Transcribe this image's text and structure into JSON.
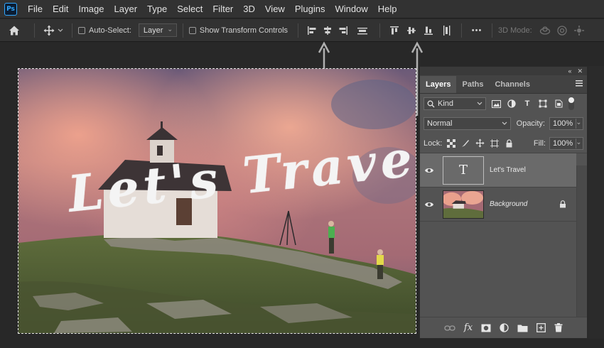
{
  "menu": [
    "File",
    "Edit",
    "Image",
    "Layer",
    "Type",
    "Select",
    "Filter",
    "3D",
    "View",
    "Plugins",
    "Window",
    "Help"
  ],
  "app_logo": "Ps",
  "options": {
    "auto_select_label": "Auto-Select:",
    "auto_select_value": "Layer",
    "show_transform_label": "Show Transform Controls",
    "more_label": "•••",
    "mode_3d_label": "3D Mode:"
  },
  "canvas": {
    "headline": "Let's Travel"
  },
  "layers_panel": {
    "tabs": [
      "Layers",
      "Paths",
      "Channels"
    ],
    "filter_kind": "Kind",
    "blend_mode": "Normal",
    "opacity_label": "Opacity:",
    "opacity_value": "100%",
    "lock_label": "Lock:",
    "fill_label": "Fill:",
    "fill_value": "100%",
    "layers": [
      {
        "name": "Let's Travel",
        "thumb_glyph": "T"
      },
      {
        "name": "Background"
      }
    ]
  },
  "icons": {
    "panel_collapse": "«",
    "panel_close": "✕"
  },
  "colors": {
    "ps_accent": "#31a8ff",
    "panel_bg": "#535353",
    "selected_layer": "#6a6a6a"
  }
}
